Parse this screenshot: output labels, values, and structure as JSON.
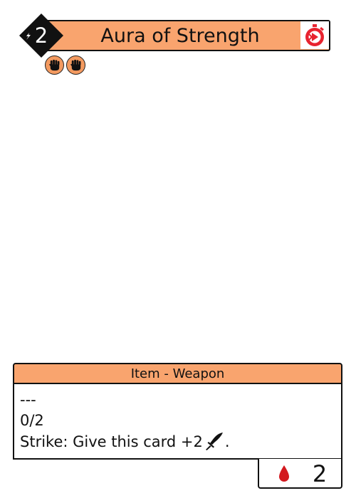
{
  "card": {
    "title": "Aura of Strength",
    "cost": "2",
    "type_line": "Item - Weapon",
    "text_lines": [
      "---",
      "0/2",
      "Strike: Give this card +2"
    ],
    "strike_suffix": ".",
    "health": "2",
    "requirements": [
      {
        "icon": "fist-icon"
      },
      {
        "icon": "fist-icon"
      }
    ],
    "speed_icon": "stopwatch-fast-icon"
  },
  "colors": {
    "banner": "#f9a46e",
    "requirement": "#f39a60",
    "speed": "#e8232f",
    "blood": "#d3191f",
    "cost_diamond": "#111111"
  }
}
